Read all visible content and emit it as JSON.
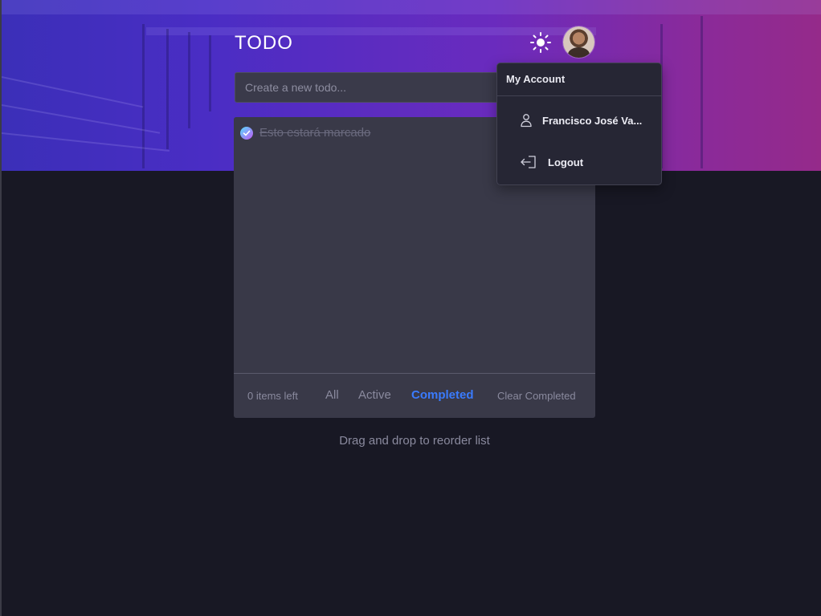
{
  "header": {
    "title": "TODO",
    "theme_icon": "sun-icon",
    "avatar_icon": "user-avatar"
  },
  "new_todo": {
    "placeholder": "Create a new todo...",
    "value": ""
  },
  "todos": [
    {
      "text": "Esto estará marcado",
      "completed": true
    }
  ],
  "footer": {
    "items_left": "0 items left",
    "filters": [
      "All",
      "Active",
      "Completed"
    ],
    "selected_filter": "Completed",
    "clear_label": "Clear Completed"
  },
  "hint": "Drag and drop to reorder list",
  "account_menu": {
    "title": "My Account",
    "user_name": "Francisco José Va...",
    "user_icon": "user-icon",
    "logout_label": "Logout",
    "logout_icon": "logout-icon"
  },
  "colors": {
    "accent": "#3a7bfd",
    "check_gradient_start": "#57ddff",
    "check_gradient_end": "#c058f3",
    "background": "#181824",
    "panel": "#393948"
  }
}
